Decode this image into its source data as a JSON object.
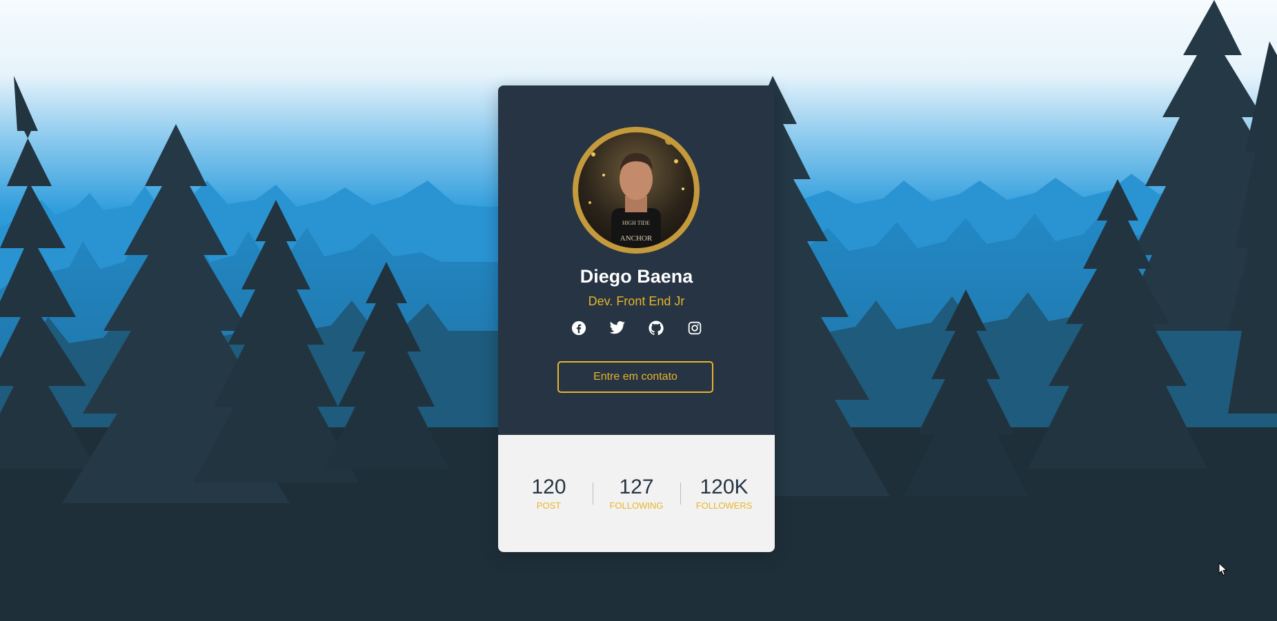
{
  "profile": {
    "name": "Diego Baena",
    "role": "Dev. Front End Jr",
    "contact_label": "Entre em contato",
    "avatar_shirt_text_top": "HIGH TIDE",
    "avatar_shirt_text_bottom": "ANCHOR"
  },
  "socials": [
    {
      "icon": "facebook-icon"
    },
    {
      "icon": "twitter-icon"
    },
    {
      "icon": "github-icon"
    },
    {
      "icon": "instagram-icon"
    }
  ],
  "stats": [
    {
      "value": "120",
      "label": "POST"
    },
    {
      "value": "127",
      "label": "FOLLOWING"
    },
    {
      "value": "120K",
      "label": "FOLLOWERS"
    }
  ],
  "colors": {
    "card_top": "#263443",
    "card_bottom": "#f2f2f2",
    "accent": "#e9b52a",
    "sky_top": "#f4f9fd",
    "sky_mid": "#2f9ddc",
    "forest_dark": "#1f2f3a"
  }
}
